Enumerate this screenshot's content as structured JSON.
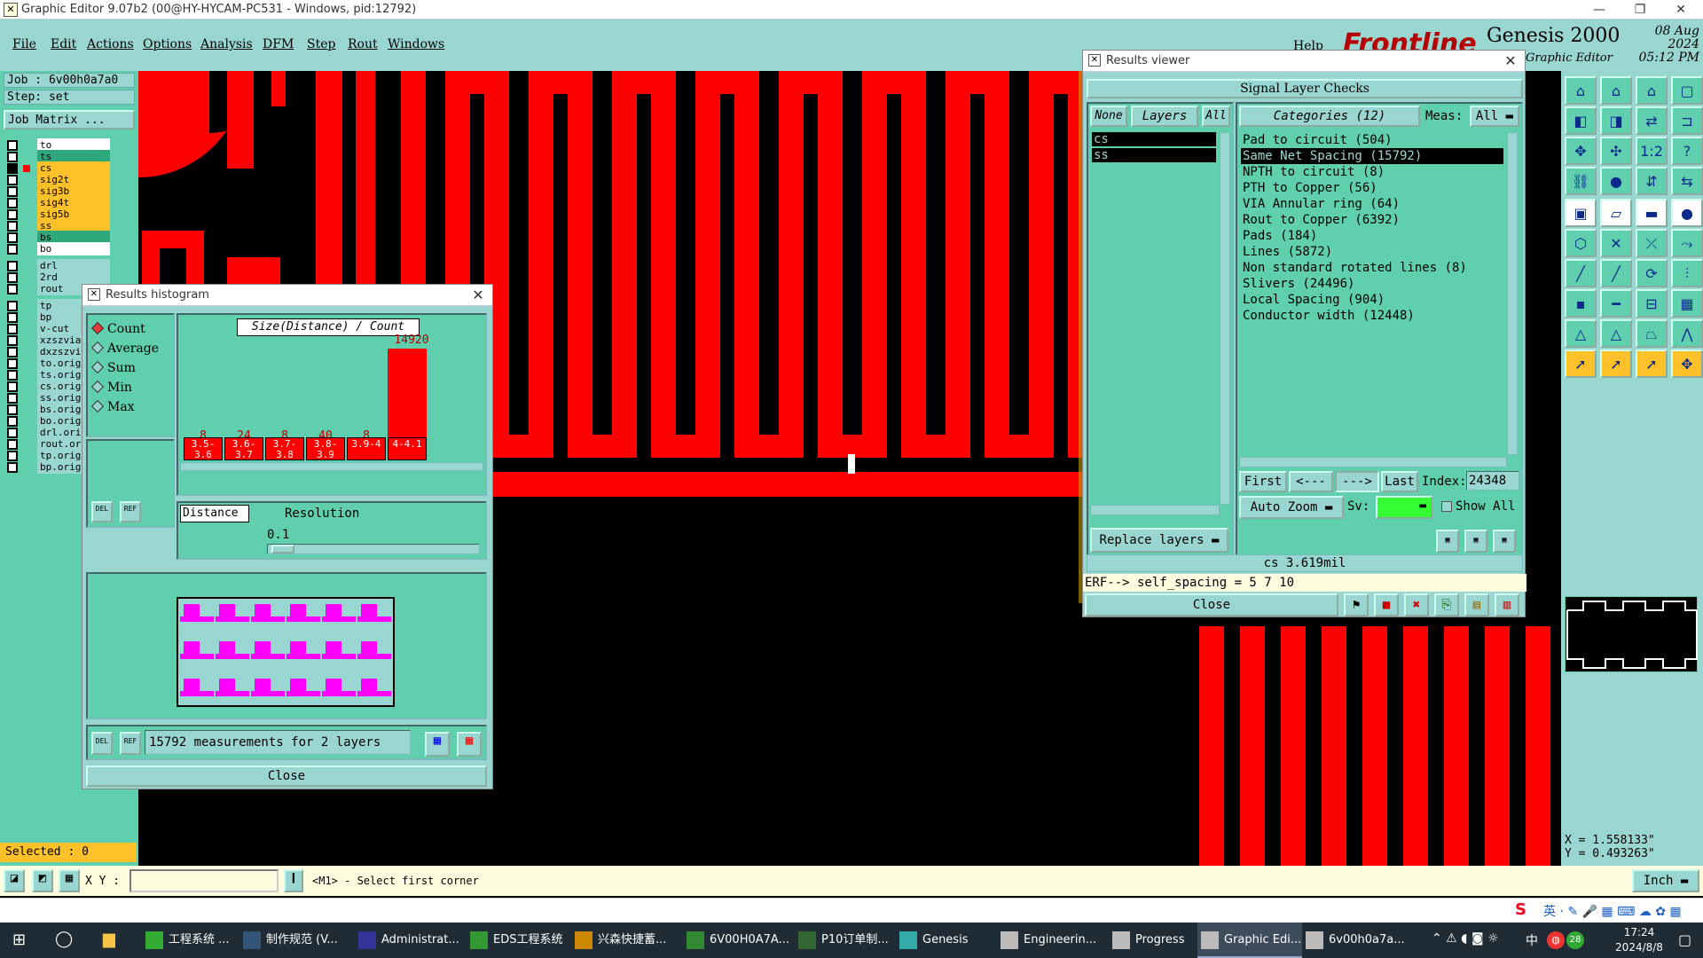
{
  "window": {
    "title": "Graphic Editor 9.07b2 (00@HY-HYCAM-PC531 - Windows, pid:12792)",
    "min": "—",
    "restore": "❐",
    "close": "✕"
  },
  "menu": [
    "File",
    "Edit",
    "Actions",
    "Options",
    "Analysis",
    "DFM",
    "Step",
    "Rout",
    "Windows"
  ],
  "help": "Help",
  "branding": {
    "logo": "Frontline",
    "product": "Genesis 2000",
    "subtitle": "Graphic Editor",
    "date": "08 Aug 2024",
    "time": "05:12 PM"
  },
  "leftpanel": {
    "job": "Job :  6v00h0a7a0",
    "step": "Step: set",
    "job_matrix": "Job Matrix ...",
    "selected": "Selected : 0",
    "layers": [
      {
        "name": "to",
        "color": "#ffffff"
      },
      {
        "name": "ts",
        "color": "#2ea87a"
      },
      {
        "name": "cs",
        "color": "#ffc12a",
        "active": true
      },
      {
        "name": "sig2t",
        "color": "#ffc12a"
      },
      {
        "name": "sig3b",
        "color": "#ffc12a"
      },
      {
        "name": "sig4t",
        "color": "#ffc12a"
      },
      {
        "name": "sig5b",
        "color": "#ffc12a"
      },
      {
        "name": "ss",
        "color": "#ffc12a"
      },
      {
        "name": "bs",
        "color": "#2ea87a"
      },
      {
        "name": "bo",
        "color": "#ffffff"
      },
      {
        "name": "drl",
        "color": "#9ad6d1"
      },
      {
        "name": "2rd",
        "color": "#9ad6d1"
      },
      {
        "name": "rout",
        "color": "#9ad6d1"
      },
      {
        "name": "tp",
        "color": "#9ad6d1"
      },
      {
        "name": "bp",
        "color": "#9ad6d1"
      },
      {
        "name": "v-cut",
        "color": "#9ad6d1"
      },
      {
        "name": "xzszvia",
        "color": "#9ad6d1"
      },
      {
        "name": "dxzszvi",
        "color": "#9ad6d1"
      },
      {
        "name": "to.orig",
        "color": "#9ad6d1"
      },
      {
        "name": "ts.orig",
        "color": "#9ad6d1"
      },
      {
        "name": "cs.orig",
        "color": "#9ad6d1"
      },
      {
        "name": "ss.orig",
        "color": "#9ad6d1"
      },
      {
        "name": "bs.orig",
        "color": "#9ad6d1"
      },
      {
        "name": "bo.orig",
        "color": "#9ad6d1"
      },
      {
        "name": "drl.ori",
        "color": "#9ad6d1"
      },
      {
        "name": "rout.or",
        "color": "#9ad6d1"
      },
      {
        "name": "tp.orig",
        "color": "#9ad6d1"
      },
      {
        "name": "bp.orig",
        "color": "#9ad6d1"
      }
    ]
  },
  "histogram": {
    "title": "Results histogram",
    "modes": [
      {
        "label": "Count",
        "checked": true
      },
      {
        "label": "Average",
        "checked": false
      },
      {
        "label": "Sum",
        "checked": false
      },
      {
        "label": "Min",
        "checked": false
      },
      {
        "label": "Max",
        "checked": false
      }
    ],
    "chart_title": "Size(Distance) / Count",
    "bins": [
      {
        "range": "3.5-3.6",
        "count": "8"
      },
      {
        "range": "3.6-3.7",
        "count": "24"
      },
      {
        "range": "3.7-3.8",
        "count": "8"
      },
      {
        "range": "3.8-3.9",
        "count": "40"
      },
      {
        "range": "3.9-4",
        "count": "8"
      },
      {
        "range": "4-4.1",
        "count": "14920"
      }
    ],
    "distance_label": "Distance",
    "resolution_label": "Resolution",
    "resolution_value": "0.1",
    "del": "DEL",
    "ref": "REF",
    "measurements": "15792 measurements for 2 layers",
    "close": "Close"
  },
  "results": {
    "title": "Results viewer",
    "header": "Signal Layer Checks",
    "none": "None",
    "layers_btn": "Layers",
    "all": "All",
    "categories_btn": "Categories (12)",
    "meas_label": "Meas:",
    "meas_value": "All",
    "layer_list": [
      "cs",
      "ss"
    ],
    "categories": [
      {
        "text": "Pad to circuit (504)",
        "selected": false
      },
      {
        "text": "Same Net Spacing (15792)",
        "selected": true
      },
      {
        "text": "NPTH to circuit (8)",
        "selected": false
      },
      {
        "text": "PTH to Copper (56)",
        "selected": false
      },
      {
        "text": "VIA Annular ring (64)",
        "selected": false
      },
      {
        "text": "Rout to Copper (6392)",
        "selected": false
      },
      {
        "text": "Pads (184)",
        "selected": false
      },
      {
        "text": "Lines (5872)",
        "selected": false
      },
      {
        "text": "Non standard rotated lines (8)",
        "selected": false
      },
      {
        "text": "Slivers (24496)",
        "selected": false
      },
      {
        "text": "Local Spacing (904)",
        "selected": false
      },
      {
        "text": "Conductor width (12448)",
        "selected": false
      }
    ],
    "first": "First",
    "prev": "<---",
    "next": "--->",
    "last": "Last",
    "index_label": "Index:",
    "index_value": "24348",
    "auto_zoom": "Auto Zoom",
    "sv": "Sv:",
    "show_all": "Show All",
    "replace_layers": "Replace layers",
    "measure": "cs 3.619mil",
    "erf": "ERF--> self_spacing = 5 7 10",
    "close": "Close"
  },
  "coords": {
    "x": "X = 1.558133\"",
    "y": "Y = 0.493263\""
  },
  "status": {
    "xy_label": "X Y :",
    "prompt": "<M1> - Select first corner",
    "units": "Inch"
  },
  "taskbar": {
    "items": [
      "工程系统 ...",
      "制作规范 (V...",
      "Administrat...",
      "EDS工程系统",
      "兴森快捷蓄...",
      "6V00H0A7A...",
      "P10订单制...",
      "Genesis",
      "Engineerin...",
      "Progress",
      "Graphic Edi...",
      "6v00h0a7a..."
    ],
    "time": "17:24",
    "date": "2024/8/8",
    "ime": "中",
    "badge": "28"
  },
  "colors": {
    "teal": "#9ad6d1",
    "green": "#5fcfae",
    "red": "#ff0000",
    "yellow": "#ffc12a",
    "magenta": "#ff00ff"
  }
}
